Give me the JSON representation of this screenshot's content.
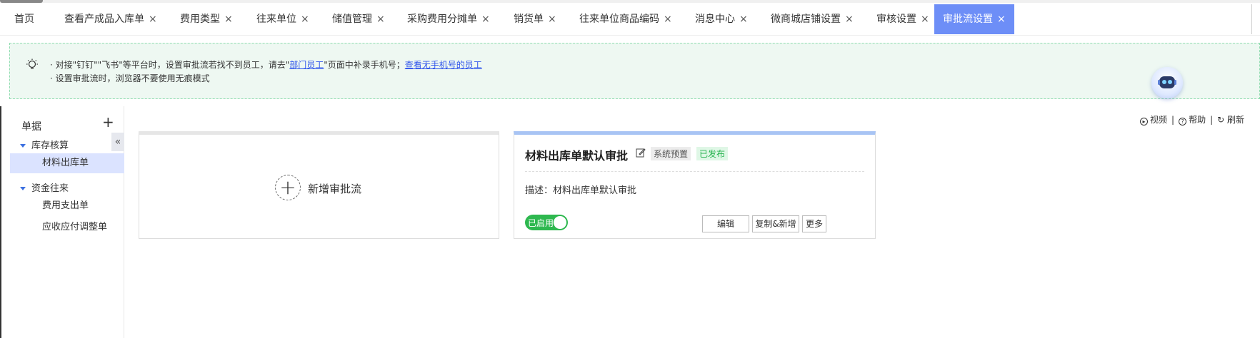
{
  "tabs": [
    {
      "label": "首页",
      "closable": false
    },
    {
      "label": "查看产成品入库单",
      "closable": true
    },
    {
      "label": "费用类型",
      "closable": true
    },
    {
      "label": "往来单位",
      "closable": true
    },
    {
      "label": "储值管理",
      "closable": true
    },
    {
      "label": "采购费用分摊单",
      "closable": true
    },
    {
      "label": "销货单",
      "closable": true
    },
    {
      "label": "往来单位商品编码",
      "closable": true
    },
    {
      "label": "消息中心",
      "closable": true
    },
    {
      "label": "微商城店铺设置",
      "closable": true
    },
    {
      "label": "审核设置",
      "closable": true
    },
    {
      "label": "审批流设置",
      "closable": true,
      "active": true
    }
  ],
  "close_glyph": "×",
  "tip": {
    "l1_a": "· 对接\"钉钉\"\"飞书\"等平台时，设置审批流若找不到员工，请去\"",
    "l1_link1": "部门员工",
    "l1_b": "\"页面中补录手机号；",
    "l1_link2": "查看无手机号的员工",
    "l2": "· 设置审批流时，浏览器不要使用无痕模式"
  },
  "sidebar": {
    "title": "单据",
    "add": "+",
    "collapse": "«",
    "groups": [
      {
        "label": "库存核算",
        "items": [
          {
            "label": "材料出库单",
            "selected": true
          }
        ]
      },
      {
        "label": "资金往来",
        "items": [
          {
            "label": "费用支出单",
            "selected": false
          },
          {
            "label": "应收应付调整单",
            "selected": false
          }
        ]
      }
    ]
  },
  "toolbar": {
    "video": "视频",
    "help": "帮助",
    "refresh": "刷新",
    "sep": "|"
  },
  "new_card": {
    "plus": "+",
    "label": "新增审批流"
  },
  "flow_card": {
    "title": "材料出库单默认审批",
    "badge_preset": "系统预置",
    "badge_published": "已发布",
    "desc": "描述：材料出库单默认审批",
    "toggle_label": "已启用",
    "enabled": true,
    "buttons": {
      "edit": "编辑",
      "copy_add": "复制&新增",
      "more": "更多"
    }
  },
  "colors": {
    "active_tab": "#6d8ef7",
    "enabled_green": "#2eb84f",
    "link": "#2f54eb",
    "tip_bg": "#eef8f2"
  }
}
